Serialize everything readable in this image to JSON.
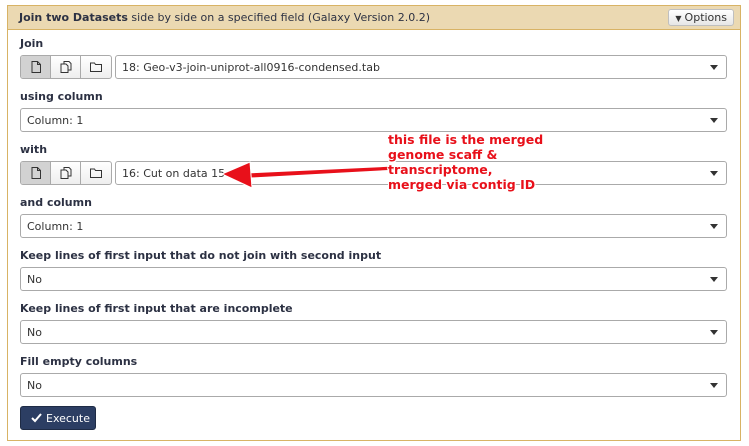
{
  "header": {
    "title_bold": "Join two Datasets",
    "title_rest": " side by side on a specified field (Galaxy Version 2.0.2)",
    "options_label": "Options"
  },
  "fields": {
    "join": {
      "label": "Join",
      "value": "18: Geo-v3-join-uniprot-all0916-condensed.tab"
    },
    "using_column": {
      "label": "using column",
      "value": "Column: 1"
    },
    "with": {
      "label": "with",
      "value": "16: Cut on data 15"
    },
    "and_column": {
      "label": "and column",
      "value": "Column: 1"
    },
    "keep_nonjoin": {
      "label": "Keep lines of first input that do not join with second input",
      "value": "No"
    },
    "keep_incomplete": {
      "label": "Keep lines of first input that are incomplete",
      "value": "No"
    },
    "fill_empty": {
      "label": "Fill empty columns",
      "value": "No"
    }
  },
  "execute_label": "Execute",
  "annotation": {
    "text": "this file is the merged genome scaff & transcriptome, merged via contig ID",
    "color": "#e8101a"
  },
  "colors": {
    "header_bg": "#ebd9b2",
    "panel_border": "#d8b365",
    "execute_bg": "#2c3e63"
  }
}
